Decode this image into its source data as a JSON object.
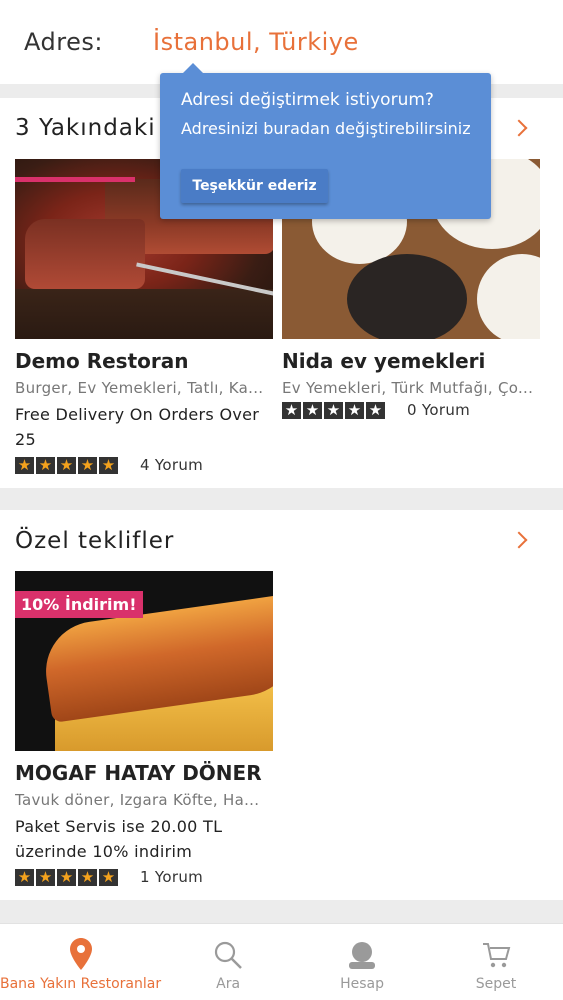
{
  "header": {
    "address_label": "Adres:",
    "address_value": "İstanbul, Türkiye"
  },
  "tooltip": {
    "line1": "Adresi değiştirmek istiyorum?",
    "line2": "Adresinizi buradan değiştirebilirsiniz",
    "button": "Teşekkür ederiz"
  },
  "nearby": {
    "title": "3 Yakındaki",
    "restaurants": [
      {
        "name": "Demo Restoran",
        "tags": "Burger, Ev Yemekleri, Tatlı, Ka...",
        "promo": "Free Delivery On Orders Over 25",
        "rating": 4.5,
        "reviews": "4 Yorum"
      },
      {
        "name": "Nida ev yemekleri",
        "tags": "Ev Yemekleri, Türk Mutfağı, Ço...",
        "promo": "",
        "rating": 0,
        "reviews": "0 Yorum"
      }
    ]
  },
  "offers": {
    "title": "Özel teklifler",
    "restaurants": [
      {
        "name": "MOGAF HATAY DÖNER",
        "badge": "10% İndirim!",
        "tags": "Tavuk döner, Izgara Köfte, Ha...",
        "promo": "Paket Servis ise 20.00 TL üzerinde 10% indirim",
        "rating": 5,
        "reviews": "1 Yorum"
      }
    ]
  },
  "tabs": [
    {
      "label": "Bana Yakın Restoranlar",
      "icon": "location-pin-icon",
      "active": true
    },
    {
      "label": "Ara",
      "icon": "search-icon",
      "active": false
    },
    {
      "label": "Hesap",
      "icon": "user-icon",
      "active": false
    },
    {
      "label": "Sepet",
      "icon": "cart-icon",
      "active": false
    }
  ],
  "colors": {
    "accent": "#e8713a",
    "tooltip": "#5b8ed6",
    "badge": "#d9316b"
  }
}
